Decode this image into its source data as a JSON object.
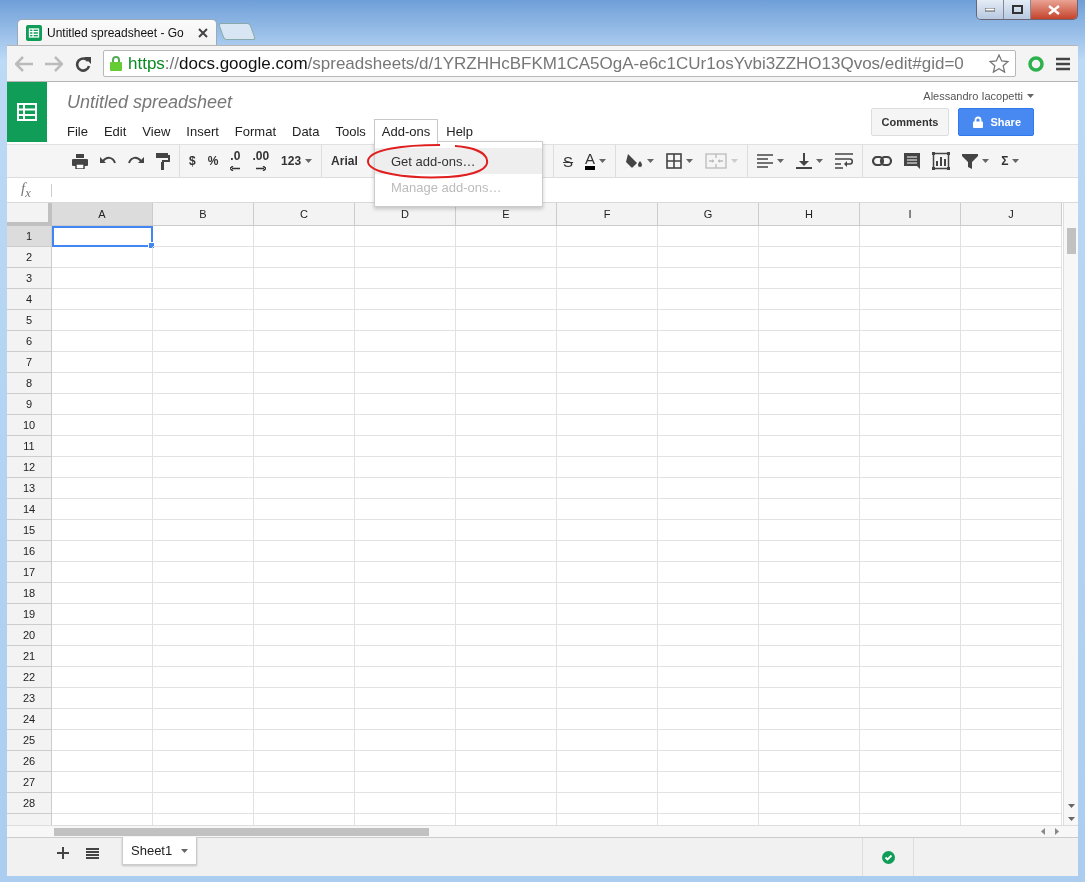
{
  "browser": {
    "tab_title": "Untitled spreadsheet - Go",
    "url_parts": [
      {
        "text": "https",
        "kind": "scheme"
      },
      {
        "text": "://",
        "kind": "dim"
      },
      {
        "text": "docs.google.com",
        "kind": "host"
      },
      {
        "text": "/spreadsheets/d/1YRZHHcBFKM1CA5OgA-e6c1CUr1osYvbi3ZZHO13Qvos/edit#gid=0",
        "kind": "dim"
      }
    ]
  },
  "document": {
    "title": "Untitled spreadsheet",
    "user": "Alessandro Iacopetti",
    "menus": [
      {
        "label": "File",
        "selected": false
      },
      {
        "label": "Edit",
        "selected": false
      },
      {
        "label": "View",
        "selected": false
      },
      {
        "label": "Insert",
        "selected": false
      },
      {
        "label": "Format",
        "selected": false
      },
      {
        "label": "Data",
        "selected": false
      },
      {
        "label": "Tools",
        "selected": false
      },
      {
        "label": "Add-ons",
        "selected": true
      },
      {
        "label": "Help",
        "selected": false
      }
    ],
    "buttons": [
      {
        "label": "Comments",
        "kind": "plain"
      },
      {
        "label": "Share",
        "kind": "primary"
      }
    ]
  },
  "toolbar": [
    {
      "items": [
        {
          "kind": "print"
        },
        {
          "kind": "undo"
        },
        {
          "kind": "redo"
        },
        {
          "kind": "paint-format"
        }
      ]
    },
    {
      "items": [
        {
          "kind": "text",
          "label": "$"
        },
        {
          "kind": "text",
          "label": "%"
        },
        {
          "kind": "decimal-decrease",
          "label": ".0"
        },
        {
          "kind": "decimal-increase",
          "label": ".00"
        },
        {
          "kind": "text",
          "label": "123",
          "dropdown": true
        }
      ]
    },
    {
      "items": [
        {
          "kind": "font",
          "label": "Arial"
        }
      ]
    },
    {
      "items": [
        {
          "kind": "strike",
          "label": "S"
        },
        {
          "kind": "text-color",
          "label": "A",
          "dropdown": true
        }
      ]
    },
    {
      "items": [
        {
          "kind": "fill",
          "dropdown": true
        },
        {
          "kind": "borders",
          "dropdown": true
        },
        {
          "kind": "merge",
          "dropdown": true,
          "disabled": true
        }
      ]
    },
    {
      "items": [
        {
          "kind": "align",
          "dropdown": true
        },
        {
          "kind": "valign",
          "dropdown": true
        },
        {
          "kind": "wrap"
        }
      ]
    },
    {
      "items": [
        {
          "kind": "link"
        },
        {
          "kind": "comment"
        },
        {
          "kind": "chart"
        },
        {
          "kind": "filter",
          "dropdown": true
        },
        {
          "kind": "text",
          "label": "Σ",
          "dropdown": true
        }
      ]
    }
  ],
  "menu": {
    "items": [
      {
        "label": "Get add-ons…",
        "selected": true,
        "disabled": false
      },
      {
        "label": "Manage add-ons…",
        "selected": false,
        "disabled": true
      }
    ]
  },
  "formula_bar": {
    "symbol": "f$_{x}$"
  },
  "grid": {
    "columns": [
      {
        "label": "A",
        "selected": true
      },
      {
        "label": "B",
        "selected": false
      },
      {
        "label": "C",
        "selected": false
      },
      {
        "label": "D",
        "selected": false
      },
      {
        "label": "E",
        "selected": false
      },
      {
        "label": "F",
        "selected": false
      },
      {
        "label": "G",
        "selected": false
      },
      {
        "label": "H",
        "selected": false
      },
      {
        "label": "I",
        "selected": false
      },
      {
        "label": "J",
        "selected": false
      }
    ],
    "rows": [
      {
        "label": "1",
        "selected": true
      },
      {
        "label": "2",
        "selected": false
      },
      {
        "label": "3",
        "selected": false
      },
      {
        "label": "4",
        "selected": false
      },
      {
        "label": "5",
        "selected": false
      },
      {
        "label": "6",
        "selected": false
      },
      {
        "label": "7",
        "selected": false
      },
      {
        "label": "8",
        "selected": false
      },
      {
        "label": "9",
        "selected": false
      },
      {
        "label": "10",
        "selected": false
      },
      {
        "label": "11",
        "selected": false
      },
      {
        "label": "12",
        "selected": false
      },
      {
        "label": "13",
        "selected": false
      },
      {
        "label": "14",
        "selected": false
      },
      {
        "label": "15",
        "selected": false
      },
      {
        "label": "16",
        "selected": false
      },
      {
        "label": "17",
        "selected": false
      },
      {
        "label": "18",
        "selected": false
      },
      {
        "label": "19",
        "selected": false
      },
      {
        "label": "20",
        "selected": false
      },
      {
        "label": "21",
        "selected": false
      },
      {
        "label": "22",
        "selected": false
      },
      {
        "label": "23",
        "selected": false
      },
      {
        "label": "24",
        "selected": false
      },
      {
        "label": "25",
        "selected": false
      },
      {
        "label": "26",
        "selected": false
      },
      {
        "label": "27",
        "selected": false
      },
      {
        "label": "28",
        "selected": false
      }
    ]
  },
  "sheets": [
    {
      "label": "Sheet1",
      "selected": true
    }
  ]
}
